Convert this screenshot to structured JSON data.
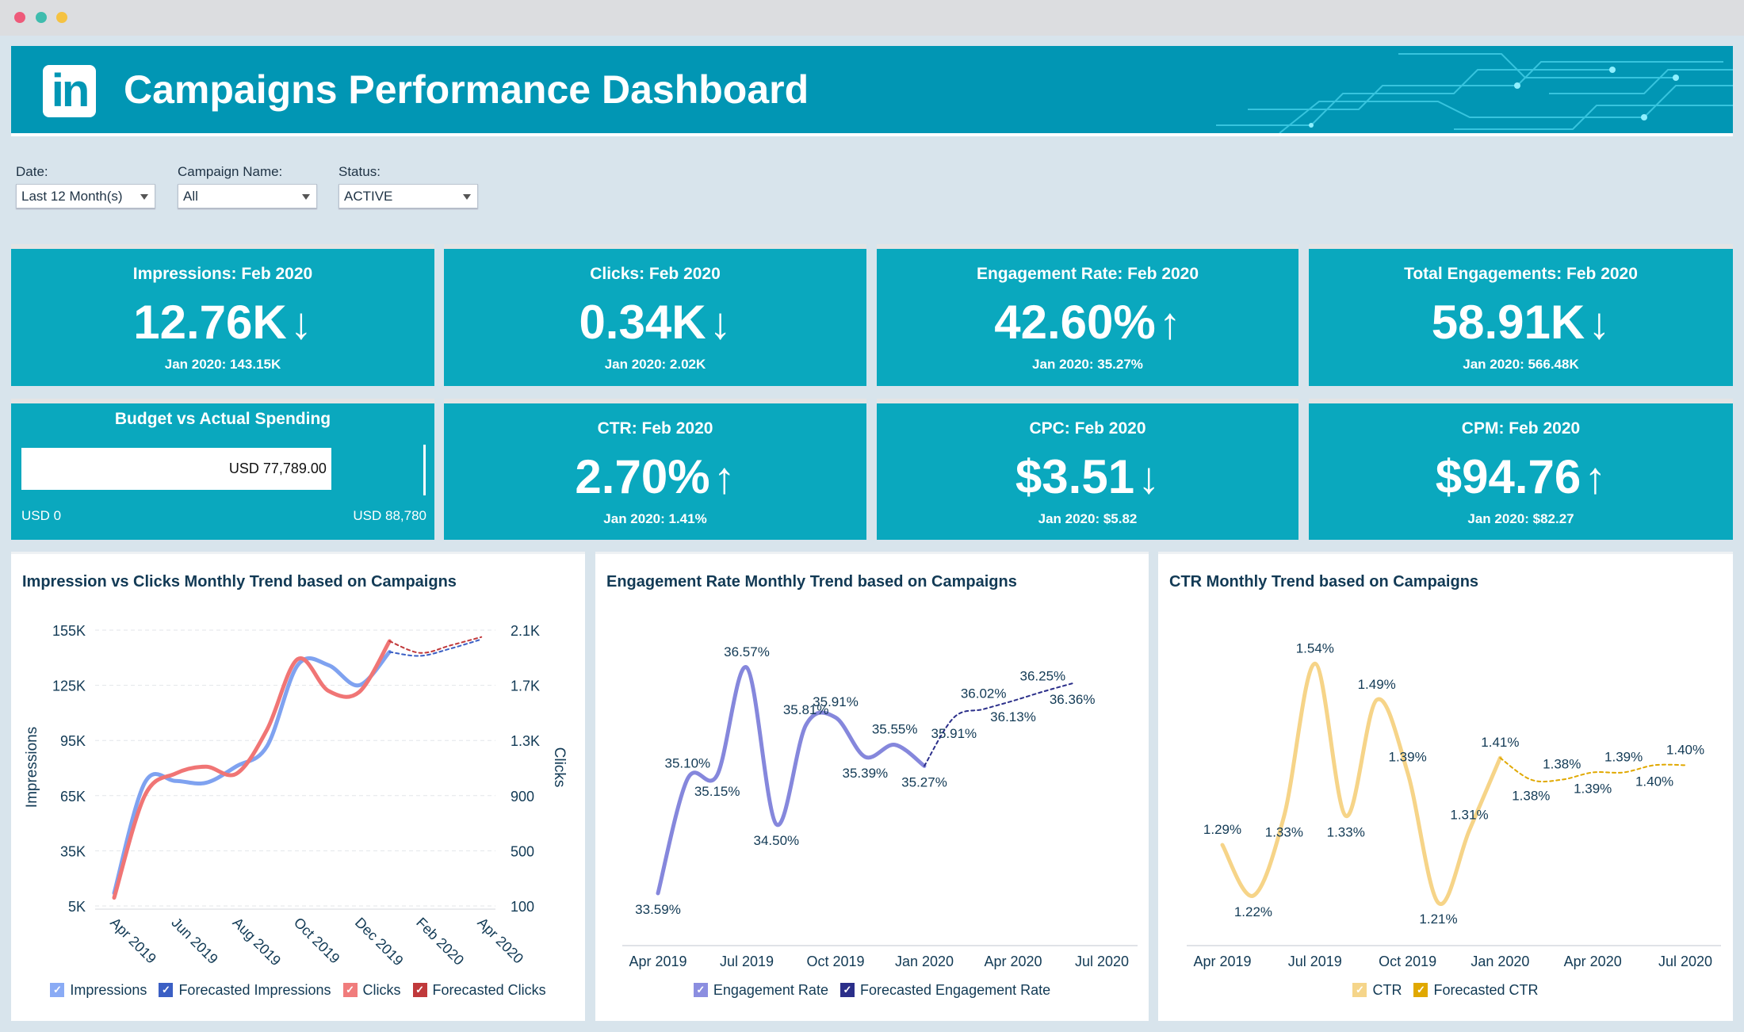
{
  "window": {
    "dots": [
      "#ee5a7a",
      "#3fbcae",
      "#f5c242"
    ]
  },
  "header": {
    "logo": "in",
    "title": "Campaigns Performance Dashboard",
    "bg": "#0196b4"
  },
  "filters": [
    {
      "label": "Date:",
      "value": "Last 12 Month(s)"
    },
    {
      "label": "Campaign Name:",
      "value": "All"
    },
    {
      "label": "Status:",
      "value": "ACTIVE"
    }
  ],
  "kpis": [
    {
      "title": "Impressions: Feb 2020",
      "value": "12.76K",
      "trend": "↓",
      "sub": "Jan 2020: 143.15K"
    },
    {
      "title": "Clicks: Feb 2020",
      "value": "0.34K",
      "trend": "↓",
      "sub": "Jan 2020: 2.02K"
    },
    {
      "title": "Engagement Rate: Feb 2020",
      "value": "42.60%",
      "trend": "↑",
      "sub": "Jan 2020: 35.27%"
    },
    {
      "title": "Total Engagements: Feb 2020",
      "value": "58.91K",
      "trend": "↓",
      "sub": "Jan 2020: 566.48K"
    },
    {
      "title": "CTR: Feb 2020",
      "value": "2.70%",
      "trend": "↑",
      "sub": "Jan 2020: 1.41%"
    },
    {
      "title": "CPC: Feb 2020",
      "value": "$3.51",
      "trend": "↓",
      "sub": "Jan 2020: $5.82"
    },
    {
      "title": "CPM: Feb 2020",
      "value": "$94.76",
      "trend": "↑",
      "sub": "Jan 2020: $82.27"
    }
  ],
  "budget": {
    "title": "Budget vs Actual Spending",
    "actual_label": "USD 77,789.00",
    "actual": 77789,
    "target": 88780,
    "min_label": "USD 0",
    "max_label": "USD 88,780"
  },
  "chart_data": [
    {
      "type": "line",
      "title": "Impression vs Clicks Monthly Trend based on Campaigns",
      "ylabel": "Impressions",
      "y2label": "Clicks",
      "categories": [
        "Apr 2019",
        "May 2019",
        "Jun 2019",
        "Jul 2019",
        "Aug 2019",
        "Sep 2019",
        "Oct 2019",
        "Nov 2019",
        "Dec 2019",
        "Jan 2020",
        "Feb 2020",
        "Mar 2020",
        "Apr 2020"
      ],
      "xticks": [
        "Apr 2019",
        "Jun 2019",
        "Aug 2019",
        "Oct 2019",
        "Dec 2019",
        "Feb 2020",
        "Apr 2020"
      ],
      "yticks": [
        "5K",
        "35K",
        "65K",
        "95K",
        "125K",
        "155K"
      ],
      "ylim": [
        5,
        155
      ],
      "y2ticks": [
        "100",
        "500",
        "900",
        "1.3K",
        "1.7K",
        "2.1K"
      ],
      "y2lim": [
        100,
        2100
      ],
      "grid": true,
      "legend": "bottom",
      "series": [
        {
          "name": "Impressions",
          "axis": "left",
          "color": "#7fa2f0",
          "dashed": false,
          "values": [
            12,
            72,
            73,
            72,
            81,
            92,
            136,
            136,
            125,
            143.15,
            null,
            null,
            null
          ]
        },
        {
          "name": "Forecasted Impressions",
          "axis": "left",
          "color": "#3b5fc4",
          "dashed": true,
          "values": [
            null,
            null,
            null,
            null,
            null,
            null,
            null,
            null,
            null,
            143.15,
            141,
            145,
            150
          ]
        },
        {
          "name": "Clicks",
          "axis": "right",
          "color": "#f07575",
          "dashed": false,
          "values": [
            160,
            900,
            1060,
            1110,
            1060,
            1380,
            1890,
            1660,
            1650,
            2020,
            null,
            null,
            null
          ]
        },
        {
          "name": "Forecasted Clicks",
          "axis": "right",
          "color": "#c0393b",
          "dashed": true,
          "values": [
            null,
            null,
            null,
            null,
            null,
            null,
            null,
            null,
            null,
            2020,
            1935,
            1990,
            2050
          ]
        }
      ],
      "legend_colors": [
        "#8aabf5",
        "#3b5fc4",
        "#f07c7c",
        "#c0393b"
      ]
    },
    {
      "type": "line",
      "title": "Engagement Rate Monthly Trend based on Campaigns",
      "categories": [
        "Apr 2019",
        "May 2019",
        "Jun 2019",
        "Jul 2019",
        "Aug 2019",
        "Sep 2019",
        "Oct 2019",
        "Nov 2019",
        "Dec 2019",
        "Jan 2020",
        "Feb 2020",
        "Mar 2020",
        "Apr 2020",
        "May 2020",
        "Jun 2020",
        "Jul 2020"
      ],
      "xticks": [
        "Apr 2019",
        "Jul 2019",
        "Oct 2019",
        "Jan 2020",
        "Apr 2020",
        "Jul 2020"
      ],
      "grid": false,
      "legend": "bottom",
      "data_labels": true,
      "series": [
        {
          "name": "Engagement Rate",
          "color": "#8587dc",
          "dashed": false,
          "values": [
            33.59,
            35.1,
            35.15,
            36.57,
            34.5,
            35.81,
            35.91,
            35.39,
            35.55,
            35.27,
            null,
            null,
            null,
            null,
            null,
            null
          ]
        },
        {
          "name": "Forecasted Engagement Rate",
          "color": "#2b2f8a",
          "dashed": true,
          "values": [
            null,
            null,
            null,
            null,
            null,
            null,
            null,
            null,
            null,
            35.27,
            35.91,
            36.02,
            36.13,
            36.25,
            36.36,
            null
          ]
        }
      ],
      "legend_colors": [
        "#8b8ee0",
        "#2b2f8a"
      ]
    },
    {
      "type": "line",
      "title": "CTR Monthly Trend based on Campaigns",
      "categories": [
        "Apr 2019",
        "May 2019",
        "Jun 2019",
        "Jul 2019",
        "Aug 2019",
        "Sep 2019",
        "Oct 2019",
        "Nov 2019",
        "Dec 2019",
        "Jan 2020",
        "Feb 2020",
        "Mar 2020",
        "Apr 2020",
        "May 2020",
        "Jun 2020",
        "Jul 2020"
      ],
      "xticks": [
        "Apr 2019",
        "Jul 2019",
        "Oct 2019",
        "Jan 2020",
        "Apr 2020",
        "Jul 2020"
      ],
      "grid": false,
      "legend": "bottom",
      "data_labels": true,
      "series": [
        {
          "name": "CTR",
          "color": "#f6d488",
          "dashed": false,
          "values": [
            1.29,
            1.22,
            1.33,
            1.54,
            1.33,
            1.49,
            1.39,
            1.21,
            1.31,
            1.41,
            null,
            null,
            null,
            null,
            null,
            null
          ]
        },
        {
          "name": "Forecasted CTR",
          "color": "#e0a800",
          "dashed": true,
          "values": [
            null,
            null,
            null,
            null,
            null,
            null,
            null,
            null,
            null,
            1.41,
            1.38,
            1.38,
            1.39,
            1.39,
            1.4,
            1.4
          ]
        }
      ],
      "legend_colors": [
        "#f5d58a",
        "#e0a800"
      ]
    }
  ]
}
